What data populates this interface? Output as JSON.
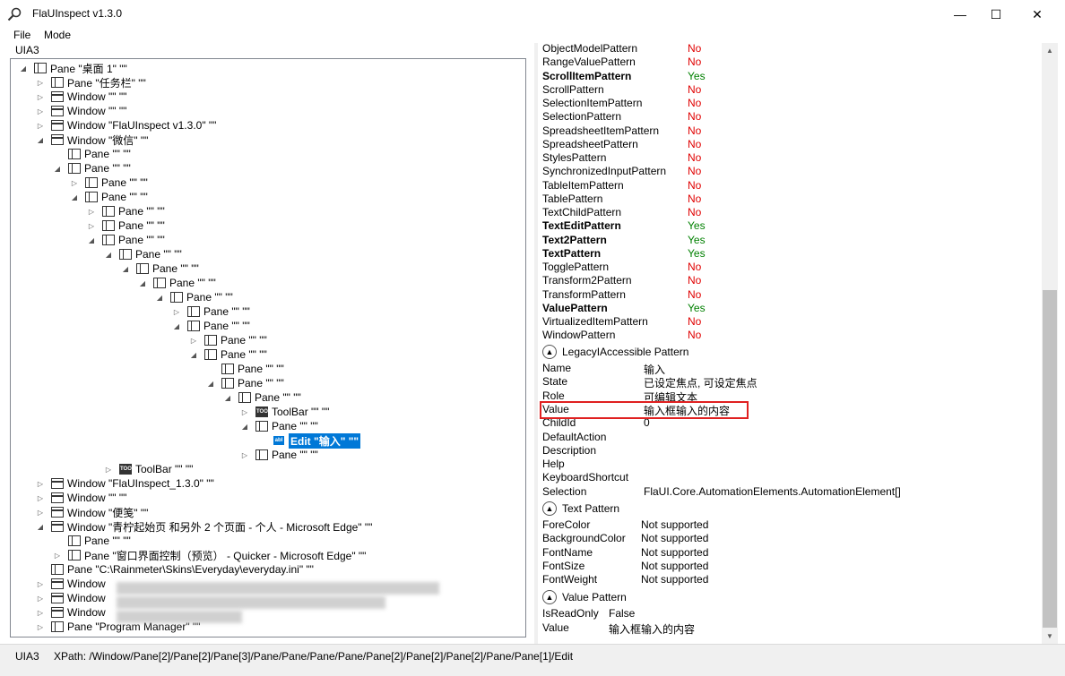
{
  "window": {
    "title": "FlaUInspect v1.3.0",
    "minimize": "—",
    "maximize": "☐",
    "close": "✕"
  },
  "menu": {
    "file": "File",
    "mode": "Mode"
  },
  "left": {
    "label": "UIA3"
  },
  "tree": [
    {
      "text": "Pane \"桌面 1\" \"\"",
      "type": "pane",
      "exp": "open"
    },
    {
      "text": "Pane \"任务栏\" \"\"",
      "type": "pane",
      "exp": "closed"
    },
    {
      "text": "Window \"\" \"\"",
      "type": "window",
      "exp": "closed"
    },
    {
      "text": "Window \"\" \"\"",
      "type": "window",
      "exp": "closed"
    },
    {
      "text": "Window \"FlaUInspect v1.3.0\" \"\"",
      "type": "window",
      "exp": "closed"
    },
    {
      "text": "Window \"微信\" \"\"",
      "type": "window",
      "exp": "open"
    },
    {
      "text": "Pane \"\" \"\"",
      "type": "pane",
      "exp": "none"
    },
    {
      "text": "Pane \"\" \"\"",
      "type": "pane",
      "exp": "open"
    },
    {
      "text": "Pane \"\" \"\"",
      "type": "pane",
      "exp": "closed"
    },
    {
      "text": "Pane \"\" \"\"",
      "type": "pane",
      "exp": "open"
    },
    {
      "text": "Pane \"\" \"\"",
      "type": "pane",
      "exp": "closed"
    },
    {
      "text": "Pane \"\" \"\"",
      "type": "pane",
      "exp": "closed"
    },
    {
      "text": "Pane \"\" \"\"",
      "type": "pane",
      "exp": "open"
    },
    {
      "text": "Pane \"\" \"\"",
      "type": "pane",
      "exp": "open"
    },
    {
      "text": "Pane \"\" \"\"",
      "type": "pane",
      "exp": "open"
    },
    {
      "text": "Pane \"\" \"\"",
      "type": "pane",
      "exp": "open"
    },
    {
      "text": "Pane \"\" \"\"",
      "type": "pane",
      "exp": "open"
    },
    {
      "text": "Pane \"\" \"\"",
      "type": "pane",
      "exp": "closed"
    },
    {
      "text": "Pane \"\" \"\"",
      "type": "pane",
      "exp": "open"
    },
    {
      "text": "Pane \"\" \"\"",
      "type": "pane",
      "exp": "closed"
    },
    {
      "text": "Pane \"\" \"\"",
      "type": "pane",
      "exp": "open"
    },
    {
      "text": "Pane \"\" \"\"",
      "type": "pane",
      "exp": "none"
    },
    {
      "text": "Pane \"\" \"\"",
      "type": "pane",
      "exp": "open"
    },
    {
      "text": "Pane \"\" \"\"",
      "type": "pane",
      "exp": "open"
    },
    {
      "text": "ToolBar \"\" \"\"",
      "type": "tool",
      "exp": "closed"
    },
    {
      "text": "Pane \"\" \"\"",
      "type": "pane",
      "exp": "open"
    },
    {
      "text": "Edit \"输入\" \"\"",
      "type": "edit",
      "exp": "none",
      "selected": true
    },
    {
      "text": "Pane \"\" \"\"",
      "type": "pane",
      "exp": "closed"
    },
    {
      "text": "ToolBar \"\" \"\"",
      "type": "tool",
      "exp": "closed"
    },
    {
      "text": "Window \"FlaUInspect_1.3.0\" \"\"",
      "type": "window",
      "exp": "closed"
    },
    {
      "text": "Window \"\" \"\"",
      "type": "window",
      "exp": "closed"
    },
    {
      "text": "Window \"便笺\" \"\"",
      "type": "window",
      "exp": "closed"
    },
    {
      "text": "Window \"青柠起始页 和另外 2 个页面 - 个人 - Microsoft Edge\" \"\"",
      "type": "window",
      "exp": "open"
    },
    {
      "text": "Pane \"\" \"\"",
      "type": "pane",
      "exp": "none"
    },
    {
      "text": "Pane \"窗口界面控制（预览） - Quicker - Microsoft Edge\" \"\"",
      "type": "pane",
      "exp": "closed"
    },
    {
      "text": "Pane \"C:\\Rainmeter\\Skins\\Everyday\\everyday.ini\" \"\"",
      "type": "pane",
      "exp": "none"
    },
    {
      "text": "Window",
      "type": "window",
      "exp": "closed"
    },
    {
      "text": "Window",
      "type": "window",
      "exp": "closed"
    },
    {
      "text": "Window",
      "type": "window",
      "exp": "closed"
    },
    {
      "text": "Pane \"Program Manager\" \"\"",
      "type": "pane",
      "exp": "closed"
    }
  ],
  "patterns": [
    {
      "name": "ObjectModelPattern",
      "value": "No"
    },
    {
      "name": "RangeValuePattern",
      "value": "No"
    },
    {
      "name": "ScrollItemPattern",
      "value": "Yes"
    },
    {
      "name": "ScrollPattern",
      "value": "No"
    },
    {
      "name": "SelectionItemPattern",
      "value": "No"
    },
    {
      "name": "SelectionPattern",
      "value": "No"
    },
    {
      "name": "SpreadsheetItemPattern",
      "value": "No"
    },
    {
      "name": "SpreadsheetPattern",
      "value": "No"
    },
    {
      "name": "StylesPattern",
      "value": "No"
    },
    {
      "name": "SynchronizedInputPattern",
      "value": "No"
    },
    {
      "name": "TableItemPattern",
      "value": "No"
    },
    {
      "name": "TablePattern",
      "value": "No"
    },
    {
      "name": "TextChildPattern",
      "value": "No"
    },
    {
      "name": "TextEditPattern",
      "value": "Yes"
    },
    {
      "name": "Text2Pattern",
      "value": "Yes"
    },
    {
      "name": "TextPattern",
      "value": "Yes"
    },
    {
      "name": "TogglePattern",
      "value": "No"
    },
    {
      "name": "Transform2Pattern",
      "value": "No"
    },
    {
      "name": "TransformPattern",
      "value": "No"
    },
    {
      "name": "ValuePattern",
      "value": "Yes"
    },
    {
      "name": "VirtualizedItemPattern",
      "value": "No"
    },
    {
      "name": "WindowPattern",
      "value": "No"
    }
  ],
  "legacy": {
    "title": "LegacyIAccessible Pattern",
    "rows": [
      {
        "k": "Name",
        "v": "输入"
      },
      {
        "k": "State",
        "v": "已设定焦点, 可设定焦点"
      },
      {
        "k": "Role",
        "v": "可编辑文本"
      },
      {
        "k": "Value",
        "v": "输入框输入的内容"
      },
      {
        "k": "ChildId",
        "v": "0"
      },
      {
        "k": "DefaultAction",
        "v": ""
      },
      {
        "k": "Description",
        "v": ""
      },
      {
        "k": "Help",
        "v": ""
      },
      {
        "k": "KeyboardShortcut",
        "v": ""
      },
      {
        "k": "Selection",
        "v": "FlaUI.Core.AutomationElements.AutomationElement[]"
      }
    ]
  },
  "text_pattern": {
    "title": "Text Pattern",
    "rows": [
      {
        "k": "ForeColor",
        "v": "Not supported"
      },
      {
        "k": "BackgroundColor",
        "v": "Not supported"
      },
      {
        "k": "FontName",
        "v": "Not supported"
      },
      {
        "k": "FontSize",
        "v": "Not supported"
      },
      {
        "k": "FontWeight",
        "v": "Not supported"
      }
    ]
  },
  "value_pattern": {
    "title": "Value Pattern",
    "rows": [
      {
        "k": "IsReadOnly",
        "v": "False"
      },
      {
        "k": "Value",
        "v": "输入框输入的内容"
      }
    ]
  },
  "status": {
    "mode": "UIA3",
    "xpath": "XPath:  /Window/Pane[2]/Pane[2]/Pane[3]/Pane/Pane/Pane/Pane/Pane[2]/Pane[2]/Pane[2]/Pane/Pane[1]/Edit"
  }
}
